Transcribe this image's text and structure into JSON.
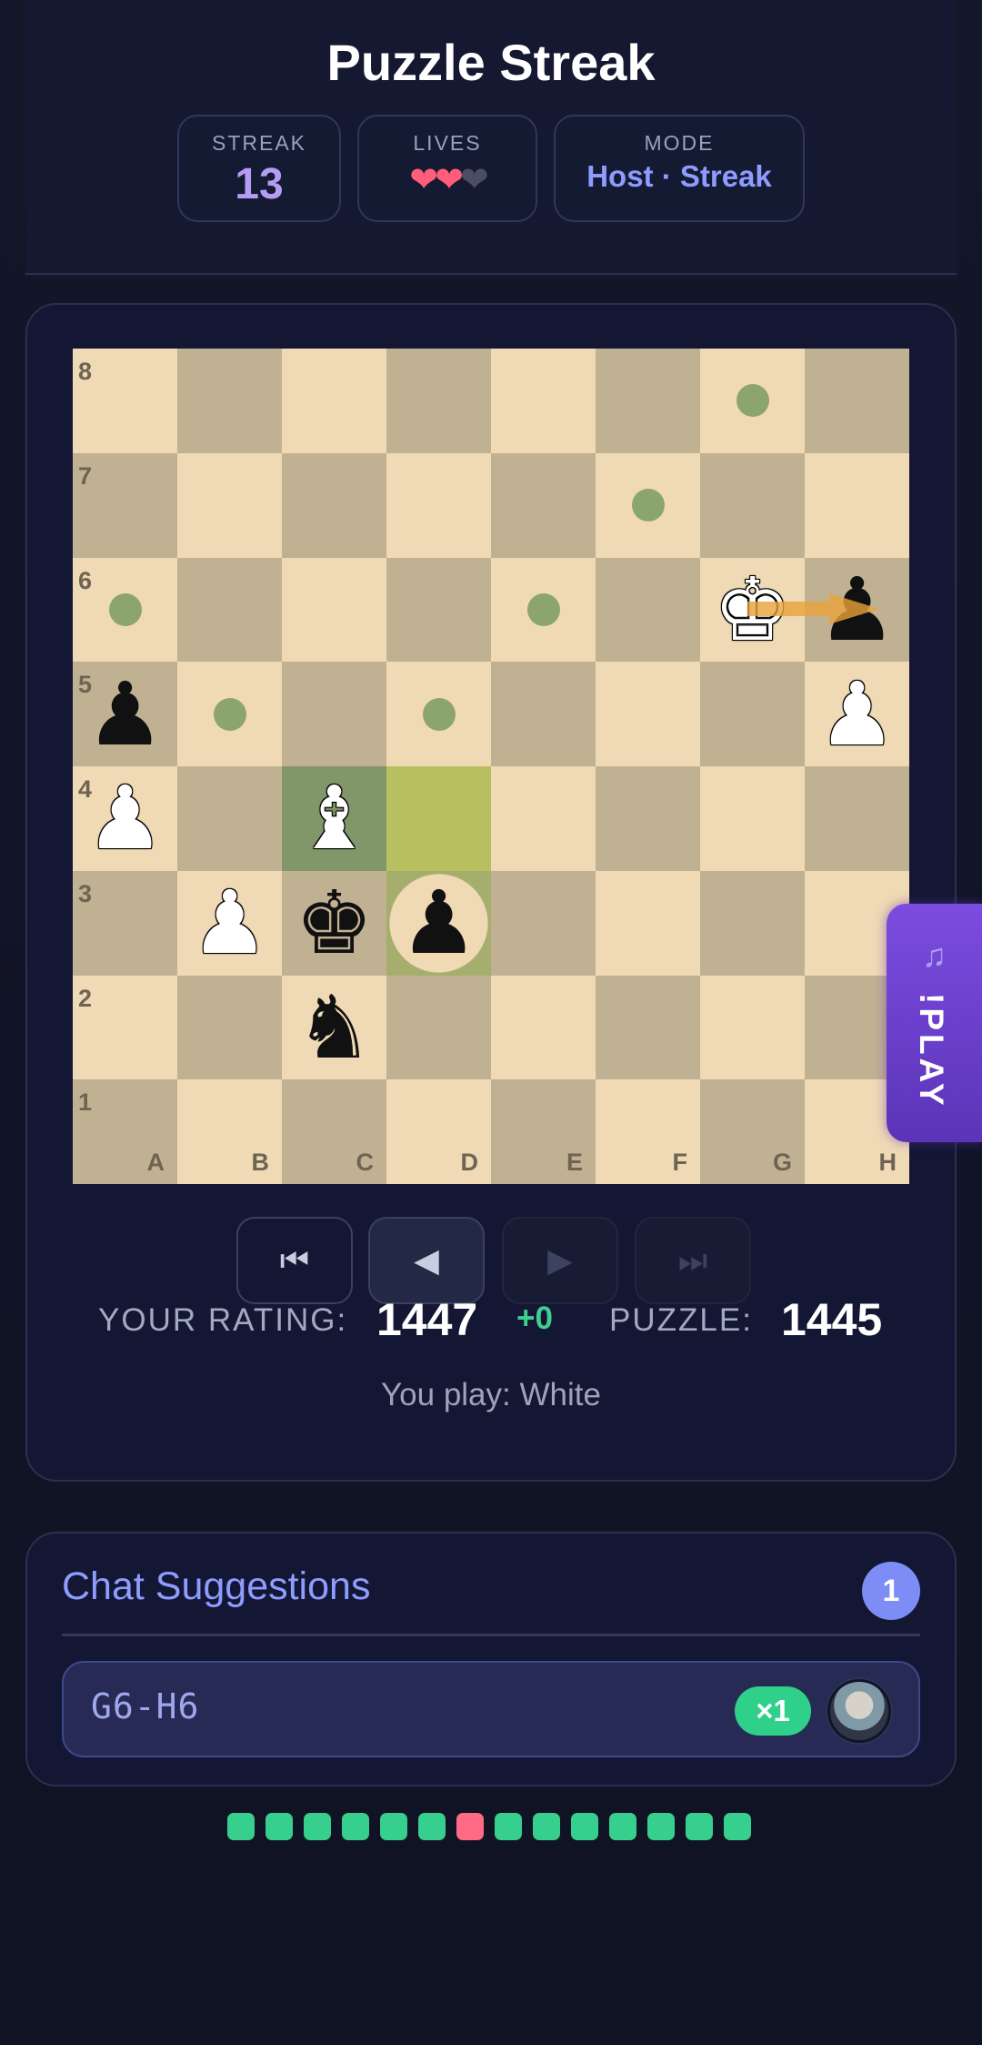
{
  "header": {
    "title": "Puzzle Streak",
    "streak_label": "STREAK",
    "streak_value": "13",
    "lives_label": "LIVES",
    "lives_total": 3,
    "lives_remaining": 2,
    "mode_label": "MODE",
    "mode_value": "Host · Streak"
  },
  "board": {
    "ranks": [
      "8",
      "7",
      "6",
      "5",
      "4",
      "3",
      "2",
      "1"
    ],
    "files": [
      "A",
      "B",
      "C",
      "D",
      "E",
      "F",
      "G",
      "H"
    ],
    "pieces": [
      {
        "square": "G6",
        "glyph": "♚",
        "color": "white",
        "icon": "white-king-icon"
      },
      {
        "square": "H6",
        "glyph": "♟",
        "color": "black",
        "icon": "black-pawn-icon"
      },
      {
        "square": "A5",
        "glyph": "♟",
        "color": "black",
        "icon": "black-pawn-icon"
      },
      {
        "square": "H5",
        "glyph": "♟",
        "color": "white",
        "icon": "white-pawn-icon"
      },
      {
        "square": "A4",
        "glyph": "♟",
        "color": "white",
        "icon": "white-pawn-icon"
      },
      {
        "square": "C4",
        "glyph": "♝",
        "color": "white",
        "icon": "white-bishop-icon"
      },
      {
        "square": "B3",
        "glyph": "♟",
        "color": "white",
        "icon": "white-pawn-icon"
      },
      {
        "square": "C3",
        "glyph": "♚",
        "color": "black",
        "icon": "black-king-icon"
      },
      {
        "square": "D3",
        "glyph": "♟",
        "color": "black",
        "icon": "black-pawn-icon"
      },
      {
        "square": "C2",
        "glyph": "♞",
        "color": "black",
        "icon": "black-knight-icon"
      }
    ],
    "move_dots": [
      "G8",
      "F7",
      "A6",
      "E6",
      "B5",
      "D5"
    ],
    "last_move_from": "C4",
    "last_move_to": "D4",
    "capture_square": "D3",
    "arrow": {
      "from": "G6",
      "to": "H6",
      "color": "#e8a33a"
    }
  },
  "controls": [
    {
      "icon": "first-move-icon",
      "glyph": "⏮",
      "state": "enabled"
    },
    {
      "icon": "previous-move-icon",
      "glyph": "◀",
      "state": "active"
    },
    {
      "icon": "next-move-icon",
      "glyph": "▶",
      "state": "disabled"
    },
    {
      "icon": "last-move-icon",
      "glyph": "⏭",
      "state": "disabled"
    }
  ],
  "ratings": {
    "your_label": "YOUR RATING:",
    "your_value": "1447",
    "delta": "+0",
    "puzzle_label": "PUZZLE:",
    "puzzle_value": "1445",
    "you_play": "You play: White"
  },
  "play_tab": {
    "icon": "music-note-icon",
    "glyph": "♫",
    "label": "!PLAY"
  },
  "chat": {
    "title": "Chat Suggestions",
    "count": "1",
    "suggestions": [
      {
        "move": "G6-H6",
        "count": "×1",
        "avatar": "user-avatar"
      }
    ]
  },
  "progress": {
    "results": [
      "correct",
      "correct",
      "correct",
      "correct",
      "correct",
      "correct",
      "wrong",
      "correct",
      "correct",
      "correct",
      "correct",
      "correct",
      "correct",
      "correct"
    ],
    "colors": {
      "correct": "#36cf8d",
      "wrong": "#ff6b84"
    }
  },
  "colors": {
    "accent": "#8e9bff",
    "streak": "#b59cf5",
    "heart": "#ff5d7a",
    "success": "#2fd08a",
    "play_tab": "#6a3fd0"
  }
}
